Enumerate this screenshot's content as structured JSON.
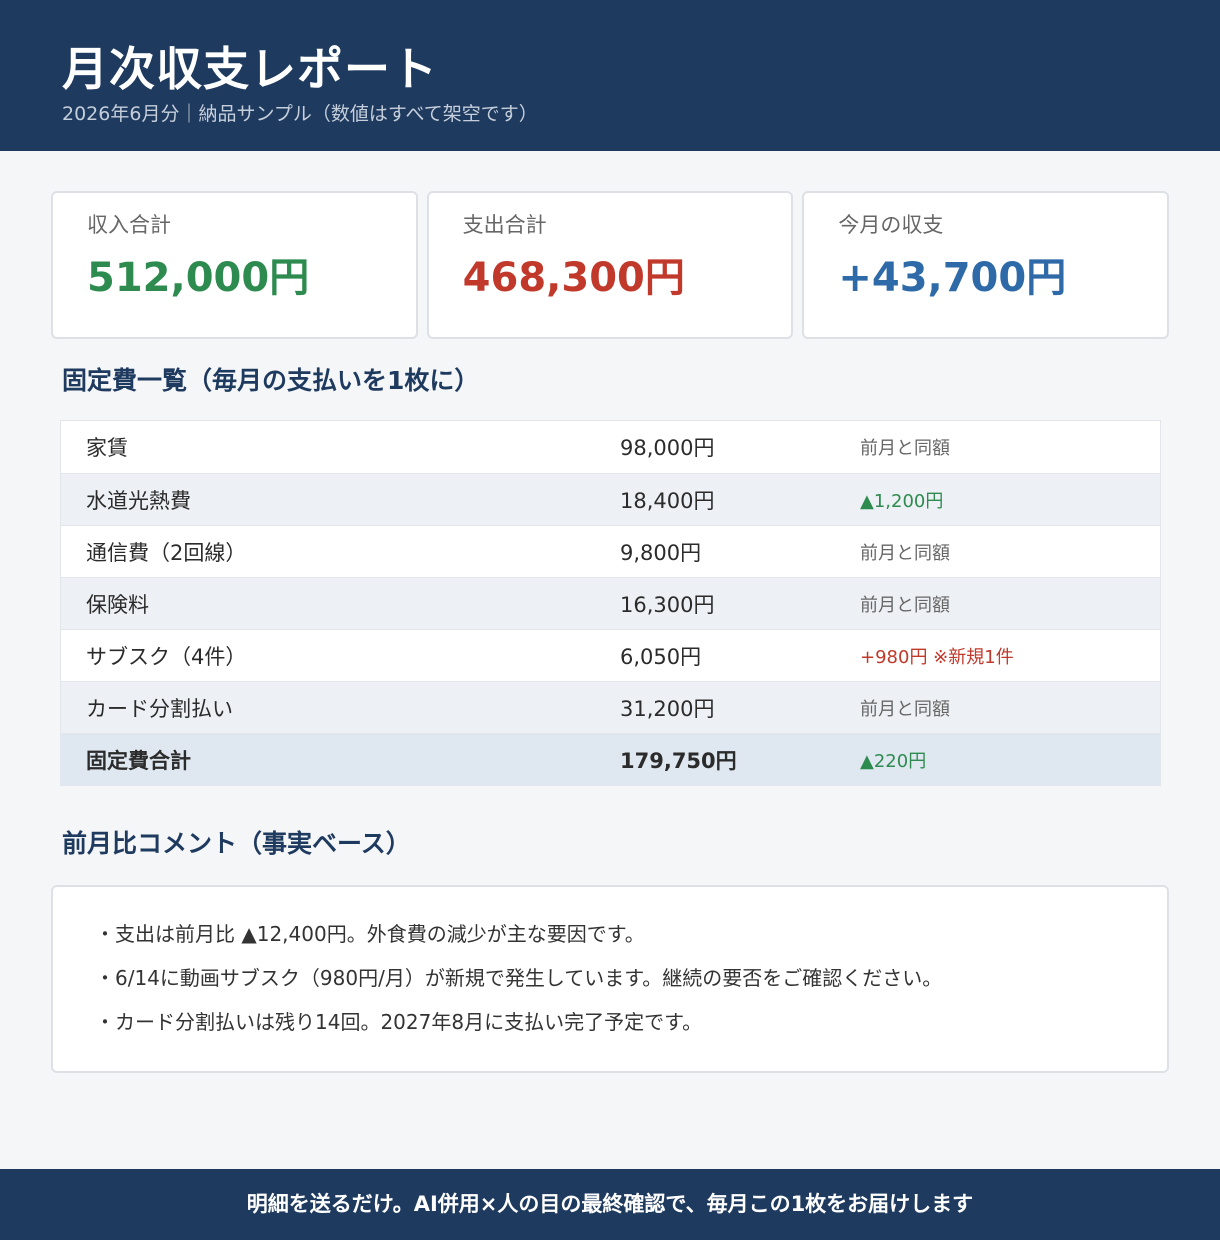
{
  "header": {
    "title": "月次収支レポート",
    "subtitle": "2026年6月分｜納品サンプル（数値はすべて架空です）"
  },
  "summary": [
    {
      "label": "収入合計",
      "value": "512,000円"
    },
    {
      "label": "支出合計",
      "value": "468,300円"
    },
    {
      "label": "今月の収支",
      "value": "+43,700円"
    }
  ],
  "fixed_costs": {
    "title": "固定費一覧（毎月の支払いを1枚に）",
    "rows": [
      {
        "name": "家賃",
        "amount": "98,000円",
        "note": "前月と同額"
      },
      {
        "name": "水道光熱費",
        "amount": "18,400円",
        "note": "▲1,200円"
      },
      {
        "name": "通信費（2回線）",
        "amount": "9,800円",
        "note": "前月と同額"
      },
      {
        "name": "保険料",
        "amount": "16,300円",
        "note": "前月と同額"
      },
      {
        "name": "サブスク（4件）",
        "amount": "6,050円",
        "note": "+980円 ※新規1件"
      },
      {
        "name": "カード分割払い",
        "amount": "31,200円",
        "note": "前月と同額"
      }
    ],
    "total": {
      "name": "固定費合計",
      "amount": "179,750円",
      "note": "▲220円"
    }
  },
  "comments": {
    "title": "前月比コメント（事実ベース）",
    "lines": [
      "・支出は前月比 ▲12,400円。外食費の減少が主な要因です。",
      "・6/14に動画サブスク（980円/月）が新規で発生しています。継続の要否をご確認ください。",
      "・カード分割払いは残り14回。2027年8月に支払い完了予定です。"
    ]
  },
  "footer": {
    "text": "明細を送るだけ。AI併用×人の目の最終確認で、毎月この1枚をお届けします"
  },
  "colors": {
    "navy": "#1f3a5f",
    "income_green": "#2e8b4f",
    "expense_red": "#c0392b",
    "balance_blue": "#2e6aa8"
  }
}
